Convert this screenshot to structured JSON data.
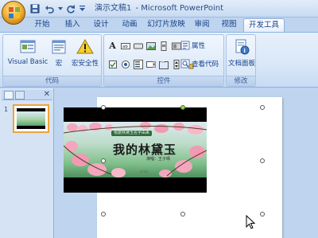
{
  "window": {
    "doc_name": "演示文稿1",
    "separator": " - ",
    "app_name": "Microsoft PowerPoint"
  },
  "tabs": [
    {
      "label": "开始",
      "active": false
    },
    {
      "label": "插入",
      "active": false
    },
    {
      "label": "设计",
      "active": false
    },
    {
      "label": "动画",
      "active": false
    },
    {
      "label": "幻灯片放映",
      "active": false
    },
    {
      "label": "审阅",
      "active": false
    },
    {
      "label": "视图",
      "active": false
    },
    {
      "label": "开发工具",
      "active": true
    }
  ],
  "ribbon": {
    "code_group": {
      "label": "代码",
      "buttons": [
        "Visual Basic",
        "宏",
        "宏安全性"
      ]
    },
    "controls_group": {
      "label": "控件",
      "properties": "属性",
      "view_code": "查看代码"
    },
    "modify_group": {
      "label": "修改",
      "doc_panel": "文档面板"
    }
  },
  "slides_pane": {
    "slide_number": "1"
  },
  "video": {
    "banner": "根据林黛玉名字由来",
    "title": "我的林黛玉",
    "subtitle": "演唱：王子晴",
    "play": "play"
  },
  "colors": {
    "ribbon_bg": "#d9e7f8",
    "accent_orange": "#f0a33a",
    "text_blue": "#15428b",
    "blossom_pink": "#f4a6bd"
  }
}
